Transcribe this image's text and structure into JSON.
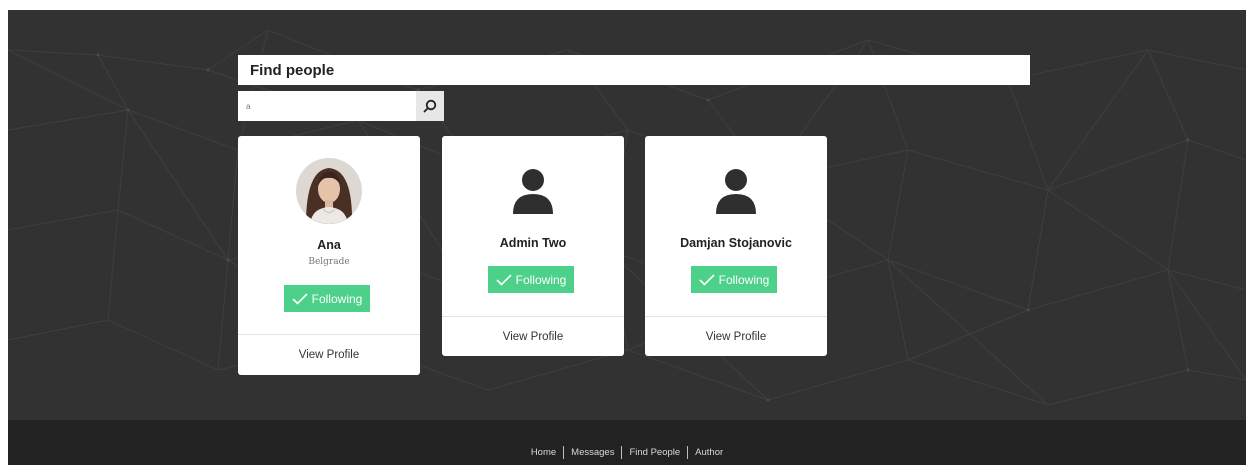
{
  "page": {
    "title": "Find people"
  },
  "search": {
    "value": "a",
    "icon": "search-icon"
  },
  "people": [
    {
      "name": "Ana",
      "city": "Belgrade",
      "avatar": "profile-photo",
      "follow_label": "Following",
      "view_label": "View Profile"
    },
    {
      "name": "Admin Two",
      "city": "",
      "avatar": "default-user-icon",
      "follow_label": "Following",
      "view_label": "View Profile"
    },
    {
      "name": "Damjan Stojanovic",
      "city": "",
      "avatar": "default-user-icon",
      "follow_label": "Following",
      "view_label": "View Profile"
    }
  ],
  "footer": {
    "links": [
      "Home",
      "Messages",
      "Find People",
      "Author"
    ]
  },
  "colors": {
    "background": "#323232",
    "footer": "#222222",
    "follow_button": "#4cd08a",
    "card": "#ffffff"
  }
}
